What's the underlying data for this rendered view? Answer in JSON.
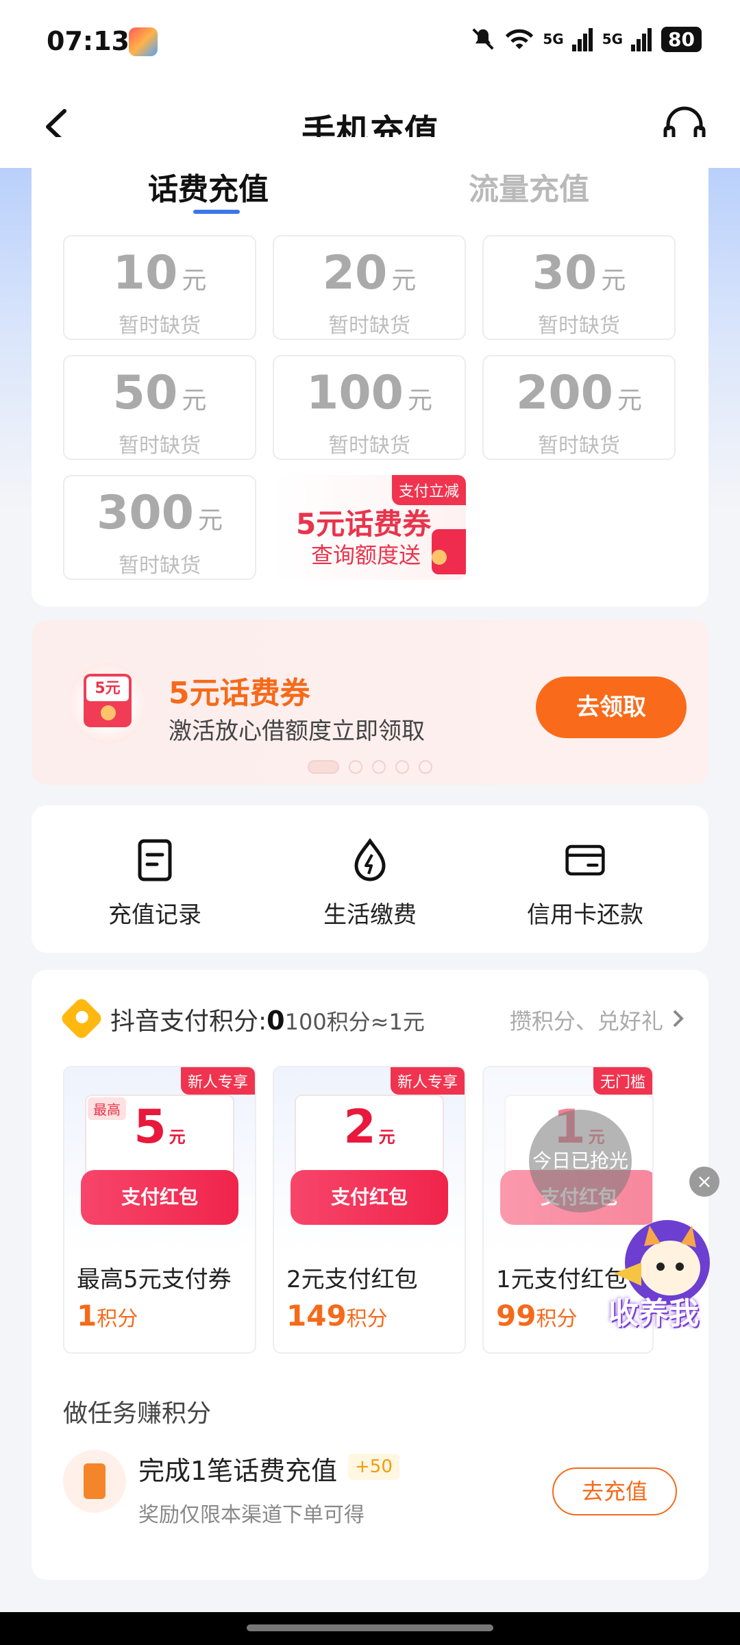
{
  "status_bar": {
    "time": "07:13",
    "network": "5G",
    "battery": "80"
  },
  "nav": {
    "title": "手机充值"
  },
  "tabs": [
    {
      "label": "话费充值",
      "active": true
    },
    {
      "label": "流量充值",
      "active": false
    }
  ],
  "amounts": [
    {
      "value": "10",
      "unit": "元",
      "status": "暂时缺货"
    },
    {
      "value": "20",
      "unit": "元",
      "status": "暂时缺货"
    },
    {
      "value": "30",
      "unit": "元",
      "status": "暂时缺货"
    },
    {
      "value": "50",
      "unit": "元",
      "status": "暂时缺货"
    },
    {
      "value": "100",
      "unit": "元",
      "status": "暂时缺货"
    },
    {
      "value": "200",
      "unit": "元",
      "status": "暂时缺货"
    },
    {
      "value": "300",
      "unit": "元",
      "status": "暂时缺货"
    }
  ],
  "promo_cell": {
    "tag": "支付立减",
    "line1": "5元话费券",
    "line2": "查询额度送"
  },
  "banner": {
    "icon_text": "5元",
    "title": "5元话费券",
    "subtitle": "激活放心借额度立即领取",
    "button": "去领取",
    "dot_count": 5,
    "active_dot": 0
  },
  "services": [
    {
      "icon": "document-icon",
      "label": "充值记录"
    },
    {
      "icon": "water-bolt-icon",
      "label": "生活缴费"
    },
    {
      "icon": "credit-card-icon",
      "label": "信用卡还款"
    }
  ],
  "points": {
    "title": "抖音支付积分:",
    "balance": "0",
    "rate": "100积分≈1元",
    "more": "攒积分、兑好礼"
  },
  "rewards": [
    {
      "badge": "新人专享",
      "max_tag": "最高",
      "amount": "5",
      "unit": "元",
      "pocket": "支付红包",
      "name": "最高5元支付券",
      "cost": "1",
      "cost_unit": "积分",
      "sold_out": false
    },
    {
      "badge": "新人专享",
      "amount": "2",
      "unit": "元",
      "pocket": "支付红包",
      "name": "2元支付红包",
      "cost": "149",
      "cost_unit": "积分",
      "sold_out": false
    },
    {
      "badge": "无门槛",
      "amount": "1",
      "unit": "元",
      "pocket": "支付红包",
      "name": "1元支付红包",
      "cost": "99",
      "cost_unit": "积分",
      "sold_out": true,
      "sold_out_text": "今日已抢光"
    }
  ],
  "tasks": {
    "heading": "做任务赚积分",
    "items": [
      {
        "title": "完成1笔话费充值",
        "reward": "+50",
        "subtitle": "奖励仅限本渠道下单可得",
        "button": "去充值"
      }
    ]
  },
  "floating": {
    "label": "收养我",
    "close": "×"
  },
  "colors": {
    "accent": "#f96b1a",
    "tab_underline": "#3b78e7",
    "red": "#e8193c"
  }
}
